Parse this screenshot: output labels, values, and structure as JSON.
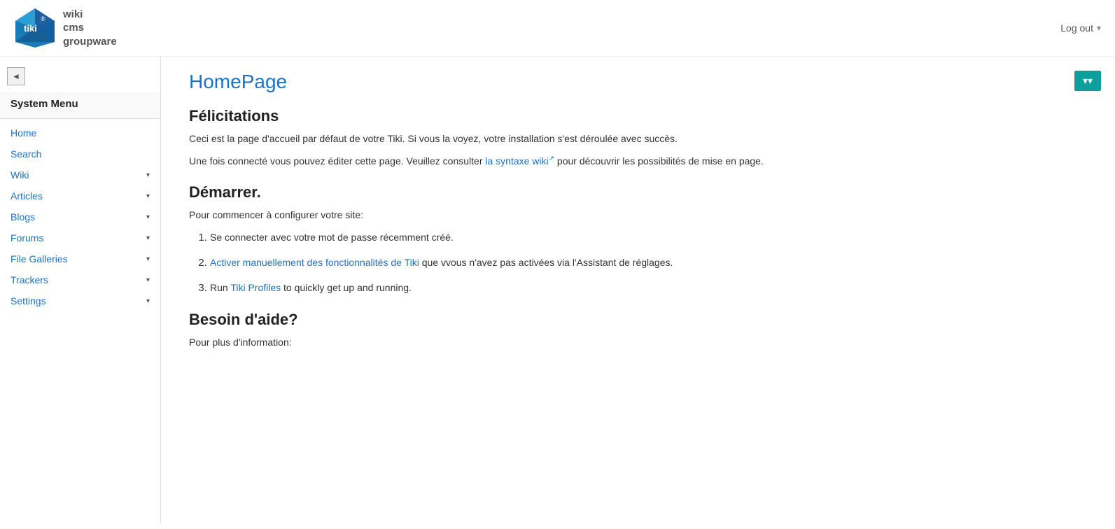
{
  "header": {
    "logout_label": "Log out",
    "logout_arrow": "▾"
  },
  "logo": {
    "text_wiki": "wiki",
    "text_cms": "cms",
    "text_groupware": "groupware"
  },
  "sidebar": {
    "collapse_icon": "◄",
    "menu_title": "System Menu",
    "items": [
      {
        "label": "Home",
        "has_arrow": false
      },
      {
        "label": "Search",
        "has_arrow": false
      },
      {
        "label": "Wiki",
        "has_arrow": true
      },
      {
        "label": "Articles",
        "has_arrow": true
      },
      {
        "label": "Blogs",
        "has_arrow": true
      },
      {
        "label": "Forums",
        "has_arrow": true
      },
      {
        "label": "File Galleries",
        "has_arrow": true
      },
      {
        "label": "Trackers",
        "has_arrow": true
      },
      {
        "label": "Settings",
        "has_arrow": true
      }
    ]
  },
  "toc_button": {
    "label": "▾▾"
  },
  "main": {
    "page_title": "HomePage",
    "section1_heading": "Félicitations",
    "para1": "Ceci est la page d'accueil par défaut de votre Tiki. Si vous la voyez, votre installation s'est déroulée avec succès.",
    "para2_before": "Une fois connecté vous pouvez éditer cette page. Veuillez consulter ",
    "para2_link": "la syntaxe wiki",
    "para2_after": " pour découvrir les possibilités de mise en page.",
    "section2_heading": "Démarrer.",
    "section2_intro": "Pour commencer à configurer votre site:",
    "list_items": [
      {
        "text": "Se connecter avec votre mot de passe récemment créé.",
        "link": null,
        "link_text": null
      },
      {
        "text_before": "",
        "link": "Activer manuellement des fonctionnalités de Tiki",
        "text_after": " que vvous n'avez pas activées via l'Assistant de réglages."
      },
      {
        "text_before": "Run ",
        "link": "Tiki Profiles",
        "text_after": " to quickly get up and running."
      }
    ],
    "section3_heading": "Besoin d'aide?",
    "section3_intro": "Pour plus d'information:"
  }
}
